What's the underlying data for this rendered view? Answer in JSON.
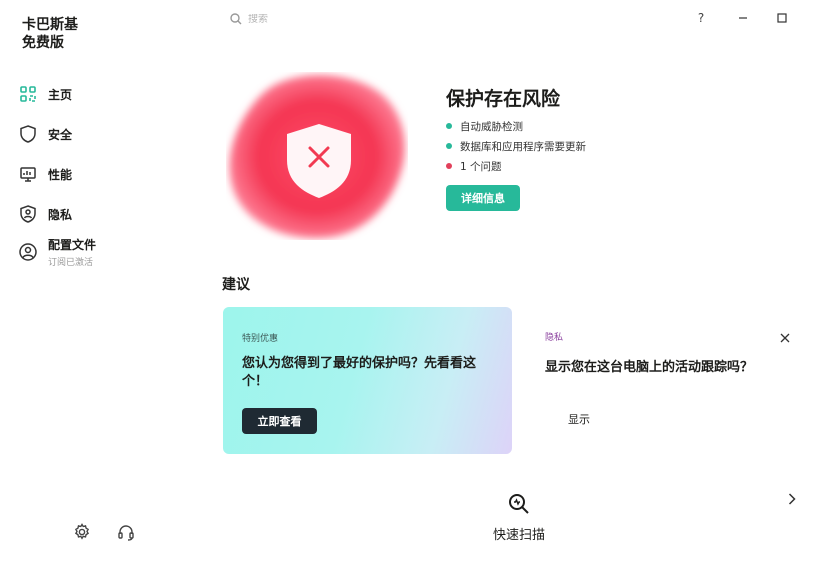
{
  "app": {
    "brand_line1": "卡巴斯基",
    "brand_line2": "免费版"
  },
  "search": {
    "placeholder": "搜索",
    "icon": "search-icon"
  },
  "window": {
    "help": "?",
    "minimize_icon": "minimize-icon",
    "maximize_icon": "maximize-icon"
  },
  "sidebar": {
    "items": [
      {
        "label": "主页",
        "icon": "home-icon"
      },
      {
        "label": "安全",
        "icon": "shield-icon"
      },
      {
        "label": "性能",
        "icon": "performance-icon"
      },
      {
        "label": "隐私",
        "icon": "privacy-icon"
      },
      {
        "label": "配置文件",
        "sublabel": "订阅已激活",
        "icon": "profile-icon"
      }
    ],
    "bottom_icons": [
      "settings-icon",
      "support-headset-icon"
    ]
  },
  "hero": {
    "title": "保护存在风险",
    "status": [
      {
        "text": "自动威胁检测",
        "color": "#27b99a"
      },
      {
        "text": "数据库和应用程序需要更新",
        "color": "#27b99a"
      },
      {
        "text": "1 个问题",
        "color": "#e2405b"
      }
    ],
    "details_button": "详细信息",
    "accent_red": "#f23a52",
    "accent_green": "#27b99a"
  },
  "recommendations": {
    "title": "建议",
    "promo": {
      "tag": "特别优惠",
      "text": "您认为您得到了最好的保护吗？先看看这个！",
      "button": "立即查看"
    },
    "privacy": {
      "tag": "隐私",
      "text": "显示您在这台电脑上的活动跟踪吗？",
      "action": "显示"
    }
  },
  "quick_scan": {
    "label": "快速扫描"
  }
}
